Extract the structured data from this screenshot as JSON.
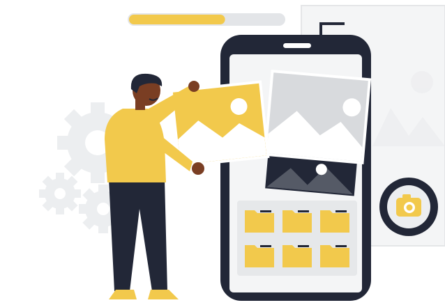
{
  "illustration": {
    "progress": {
      "fraction": 0.62
    },
    "gallery": {
      "photo_count": 3,
      "folder_count": 6
    },
    "colors": {
      "accent_yellow": "#F2C94C",
      "dark_navy": "#222737",
      "gear_gray": "#ECEEF0",
      "panel_gray": "#F4F5F6",
      "photo_gray": "#D8DADD",
      "skin": "#7A3E23"
    },
    "icons": [
      "gear-icon",
      "camera-icon",
      "folder-icon",
      "image-icon"
    ]
  }
}
